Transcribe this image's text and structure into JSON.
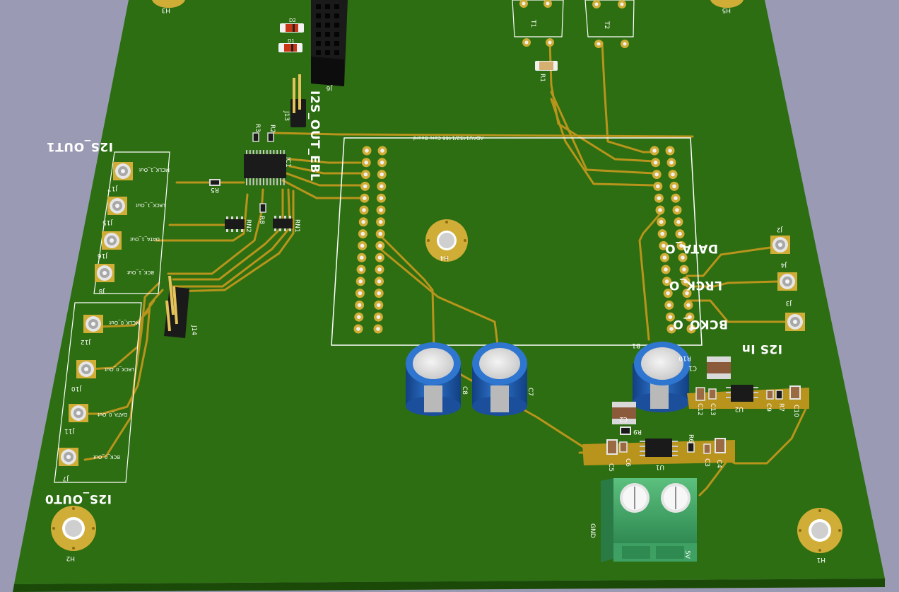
{
  "scene": "3D render of a green PCB (KiCad 3D viewer)",
  "colors": {
    "background": "#9a9ab4",
    "board": "#2c6e11",
    "board_edge": "#1b4a08",
    "copper": "#b8941c",
    "silk": "#ffffff",
    "pad_gold": "#d0ad36",
    "cap_blue": "#1e5fb8",
    "terminal_green": "#4fb070",
    "header_black": "#1a1a1a"
  },
  "labels": {
    "i2s_out1": "I2S_OUT1",
    "i2s_out0": "I2S_OUT0",
    "i2s_out_ebl": "I2S_OUT_EBL",
    "i2s_in": "I2S In",
    "data_o": "DATA_O",
    "lrck_o": "LRCK_O",
    "bcko_o": "BCKO_O",
    "core_board": "ADAU1452/1466 Core Board",
    "gnd": "GND",
    "five_v": "5V"
  },
  "refs": {
    "h1": "H1",
    "h2": "H2",
    "h3": "H3",
    "h4": "H4",
    "h5": "H5",
    "j2": "J2",
    "j3": "J3",
    "j4": "J4",
    "j6": "J6",
    "j7": "J7",
    "j8": "J8",
    "j10": "J10",
    "j11": "J11",
    "j12": "J12",
    "j13": "J13",
    "j14": "J14",
    "j15": "J15",
    "j16": "J16",
    "j17": "J17",
    "c1": "C1",
    "c2": "C2",
    "c3": "C3",
    "c4": "C4",
    "c5": "C5",
    "c6": "C6",
    "c7": "C7",
    "c8": "C8",
    "c9": "C9",
    "c10": "C10",
    "c12": "C12",
    "c13": "C13",
    "r1": "R1",
    "r2": "R2",
    "r3": "R3",
    "r5": "R5",
    "r6": "R6",
    "r7": "R7",
    "r8": "R8",
    "r9": "R9",
    "r10": "R10",
    "rn1": "RN1",
    "rn2": "RN2",
    "ic1": "IC1",
    "u1": "U1",
    "u2": "U2",
    "t1": "T1",
    "t2": "T2",
    "d1": "D1",
    "d2": "D2",
    "c_b": "B1"
  },
  "net_labels": {
    "mclk1": "MCLK_1_Out",
    "lrck1": "LRCK_1_Out",
    "data1": "DATA_1_Out",
    "bck1": "BCK_1_Out",
    "mclk0": "MCLK_0_Out",
    "lrck0": "LRCK_0_Out",
    "data0": "DATA_0_Out",
    "bck0": "BCK_0_Out"
  }
}
